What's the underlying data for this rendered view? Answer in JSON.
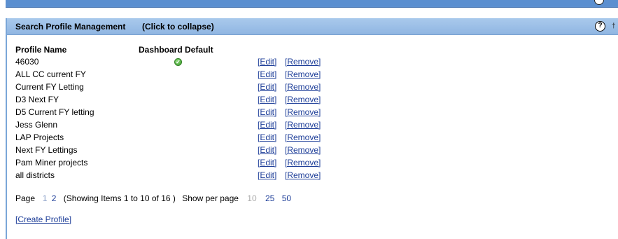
{
  "panel": {
    "title": "Search Profile Management",
    "collapse_hint": "(Click to collapse)",
    "help_icon": "?",
    "pin_icon": "†"
  },
  "table": {
    "col_profile_name": "Profile Name",
    "col_dashboard_default": "Dashboard Default",
    "rows": [
      {
        "name": "46030",
        "is_default": true,
        "edit": "[Edit]",
        "remove": "[Remove]"
      },
      {
        "name": "ALL CC current FY",
        "is_default": false,
        "edit": "[Edit]",
        "remove": "[Remove]"
      },
      {
        "name": "Current FY Letting",
        "is_default": false,
        "edit": "[Edit]",
        "remove": "[Remove]"
      },
      {
        "name": "D3 Next FY",
        "is_default": false,
        "edit": "[Edit]",
        "remove": "[Remove]"
      },
      {
        "name": "D5 Current FY letting",
        "is_default": false,
        "edit": "[Edit]",
        "remove": "[Remove]"
      },
      {
        "name": "Jess Glenn",
        "is_default": false,
        "edit": "[Edit]",
        "remove": "[Remove]"
      },
      {
        "name": "LAP Projects",
        "is_default": false,
        "edit": "[Edit]",
        "remove": "[Remove]"
      },
      {
        "name": "Next FY Lettings",
        "is_default": false,
        "edit": "[Edit]",
        "remove": "[Remove]"
      },
      {
        "name": "Pam Miner projects",
        "is_default": false,
        "edit": "[Edit]",
        "remove": "[Remove]"
      },
      {
        "name": "all districts",
        "is_default": false,
        "edit": "[Edit]",
        "remove": "[Remove]"
      }
    ]
  },
  "pager": {
    "page_label": "Page",
    "page_current": "1",
    "page_other": "2",
    "showing": "(Showing Items 1 to 10 of 16 )",
    "per_page_label": "Show per page",
    "per_page_current": "10",
    "per_page_25": "25",
    "per_page_50": "50"
  },
  "create_profile": "[Create Profile]",
  "colors": {
    "header_bg": "#9dc0e8",
    "link": "#1f3f99",
    "check_green": "#3b9a2c"
  }
}
